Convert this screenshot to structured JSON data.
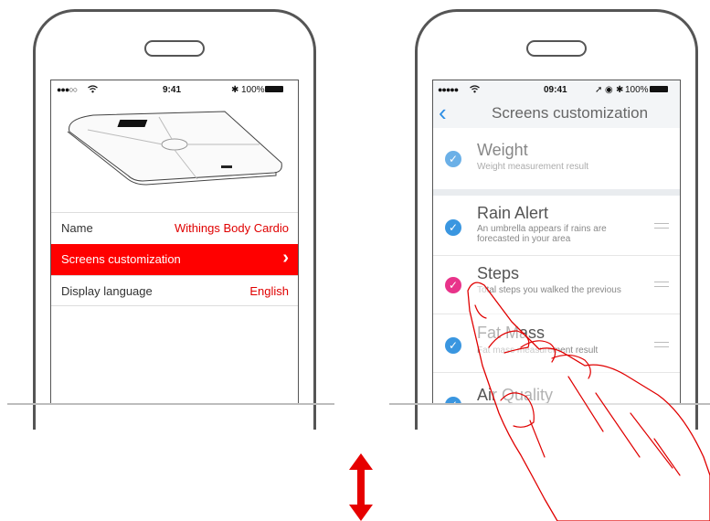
{
  "left_phone": {
    "status": {
      "signal": "●●●○○",
      "time": "9:41",
      "battery": "100%"
    },
    "rows": [
      {
        "label": "Name",
        "value": "Withings Body Cardio"
      },
      {
        "label": "Screens customization",
        "value": "›"
      },
      {
        "label": "Display language",
        "value": "English"
      }
    ]
  },
  "right_phone": {
    "status": {
      "signal": "●●●●●",
      "time": "09:41",
      "battery": "100%"
    },
    "nav": {
      "back": "‹",
      "title": "Screens customization"
    },
    "items": [
      {
        "title": "Weight",
        "subtitle": "Weight measurement result"
      },
      {
        "title": "Rain Alert",
        "subtitle": "An umbrella appears if rains are forecasted in your area"
      },
      {
        "title": "Steps",
        "subtitle": "Total steps you walked the previous"
      },
      {
        "title": "Fat Mass",
        "subtitle": "Fat mass measurement result"
      },
      {
        "title": "Air Quality",
        "subtitle": ""
      }
    ]
  },
  "colors": {
    "accent_red": "#ff0000",
    "check_blue": "#3a96e0",
    "check_pink": "#e8338a"
  },
  "icons": [
    "wifi-icon",
    "bluetooth-icon",
    "battery-icon",
    "location-icon",
    "alarm-icon",
    "check-icon",
    "back-chevron-icon",
    "drag-handle-icon",
    "up-down-arrow-icon",
    "hand-pointer-icon"
  ]
}
